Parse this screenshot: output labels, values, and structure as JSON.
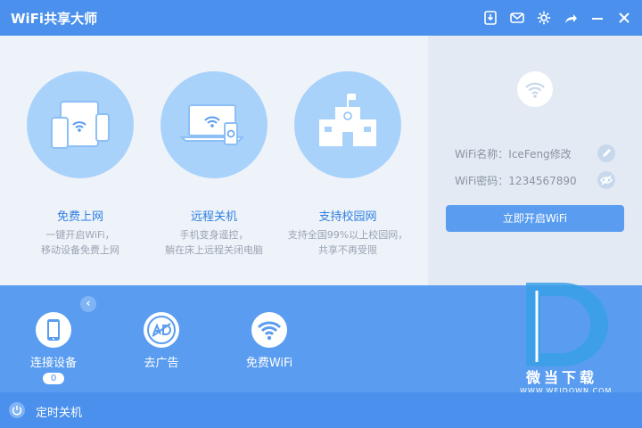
{
  "app": {
    "title": "WiFi共享大师"
  },
  "titlebar": {
    "icons": [
      "download-icon",
      "mail-icon",
      "settings-icon",
      "share-icon",
      "minimize-icon",
      "close-icon"
    ]
  },
  "features": [
    {
      "name": "免费上网",
      "desc1": "一键开启WiFi，",
      "desc2": "移动设备免费上网",
      "icon": "devices-icon"
    },
    {
      "name": "远程关机",
      "desc1": "手机变身遥控，",
      "desc2": "躺在床上远程关闭电脑",
      "icon": "laptop-phone-icon"
    },
    {
      "name": "支持校园网",
      "desc1": "支持全国99%以上校园网，",
      "desc2": "共享不再受限",
      "icon": "school-icon"
    }
  ],
  "side": {
    "wifi_name": "WiFi名称：IceFeng修改",
    "wifi_password": "WiFi密码：1234567890",
    "start_button": "立即开启WiFi"
  },
  "tools": [
    {
      "label": "连接设备",
      "badge": "0",
      "icon": "phone-icon"
    },
    {
      "label": "去广告",
      "icon": "no-ad-icon"
    },
    {
      "label": "免费WiFi",
      "icon": "wifi-icon"
    }
  ],
  "watermark": {
    "brand": "微当下载",
    "url": "WWW.WEIDOWN.COM"
  },
  "footer": {
    "label": "定时关机"
  },
  "colors": {
    "titlebar": "#4a90ec",
    "accent": "#5a9df0",
    "circle": "#a9d2fb",
    "main_bg": "#eef3fa",
    "side_bg": "#e3eaf3"
  }
}
